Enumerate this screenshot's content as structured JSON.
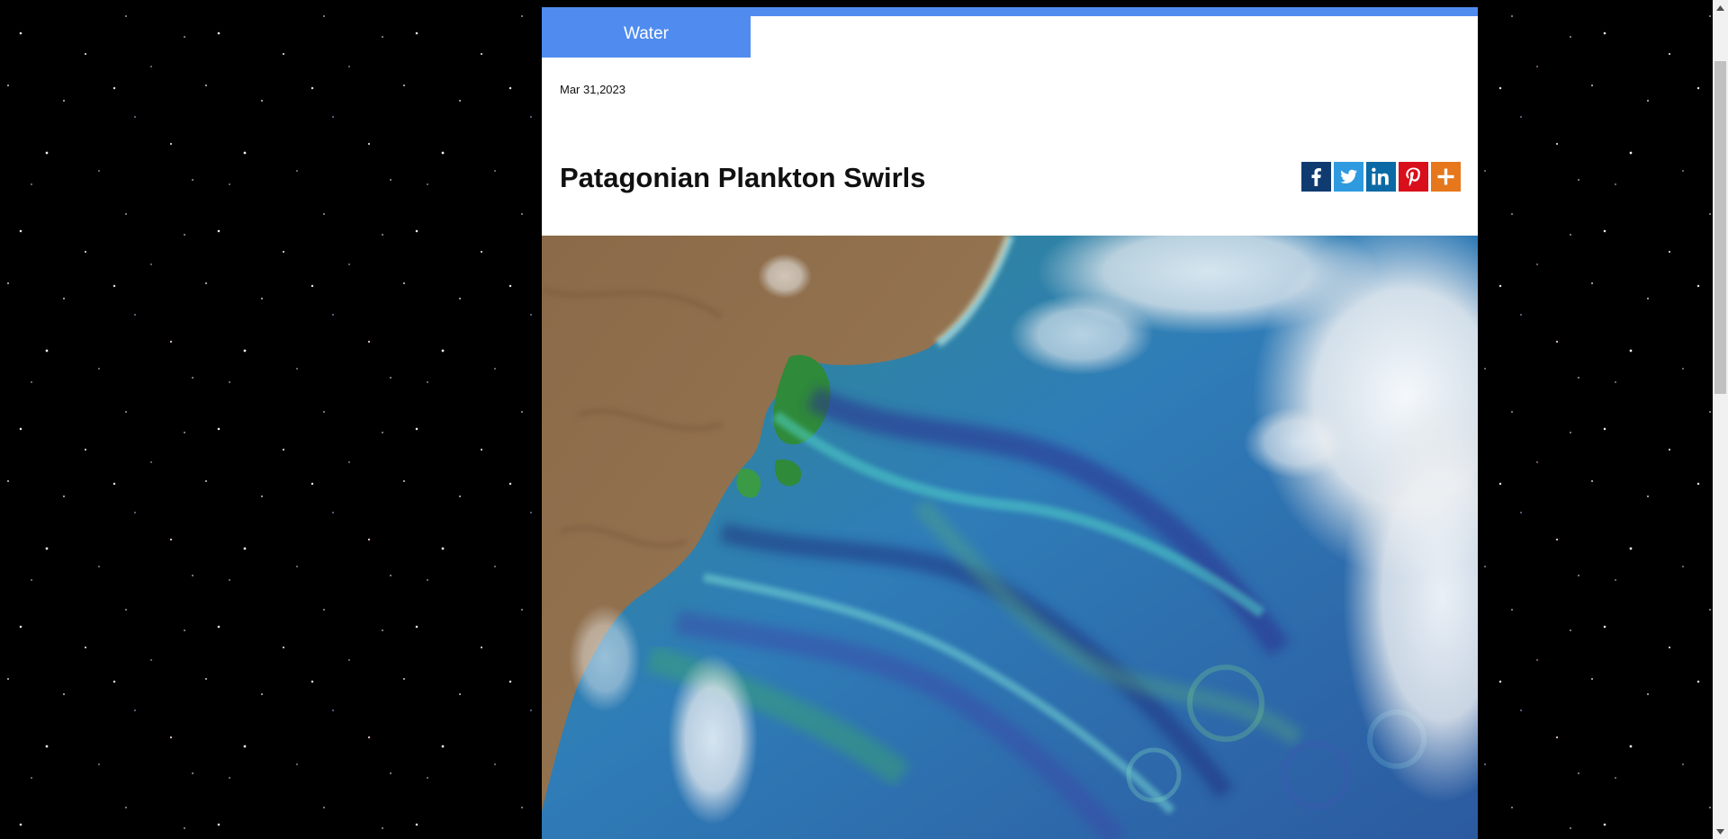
{
  "article": {
    "category": "Water",
    "date": "Mar 31,2023",
    "title": "Patagonian Plankton Swirls"
  },
  "share": [
    {
      "name": "facebook",
      "icon": "facebook-icon",
      "color": "#0f3b70"
    },
    {
      "name": "twitter",
      "icon": "twitter-icon",
      "color": "#2f9ae0"
    },
    {
      "name": "linkedin",
      "icon": "linkedin-icon",
      "color": "#0b6aa6"
    },
    {
      "name": "pinterest",
      "icon": "pinterest-icon",
      "color": "#d90f1b"
    },
    {
      "name": "more",
      "icon": "plus-icon",
      "color": "#e6771c"
    }
  ],
  "colors": {
    "accent": "#508cf0",
    "background": "#000000"
  },
  "image": {
    "subject": "satellite-image"
  }
}
